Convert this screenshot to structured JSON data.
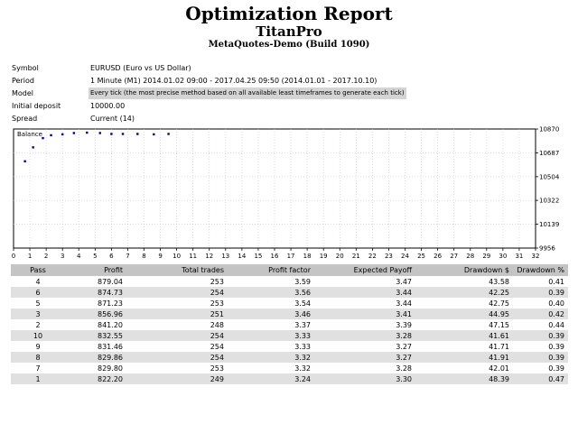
{
  "report": {
    "title": "Optimization Report",
    "expert": "TitanPro",
    "server": "MetaQuotes-Demo (Build 1090)"
  },
  "info": [
    {
      "label": "Symbol",
      "value": "EURUSD (Euro vs US Dollar)"
    },
    {
      "label": "Period",
      "value": "1 Minute (M1) 2014.01.02 09:00 - 2017.04.25 09:50 (2014.01.01 - 2017.10.10)"
    },
    {
      "label": "Model",
      "value": "Every tick (the most precise method based on all available least timeframes to generate each tick)"
    },
    {
      "label": "Initial deposit",
      "value": "10000.00"
    },
    {
      "label": "Spread",
      "value": "Current (14)"
    }
  ],
  "chart_data": {
    "type": "scatter",
    "title": "Balance",
    "xlim": [
      0,
      32
    ],
    "ylim": [
      9956,
      10870
    ],
    "x_ticks": [
      0,
      1,
      2,
      3,
      4,
      5,
      6,
      7,
      8,
      9,
      10,
      11,
      12,
      13,
      14,
      15,
      16,
      17,
      18,
      19,
      20,
      21,
      22,
      23,
      24,
      25,
      26,
      27,
      28,
      29,
      30,
      31,
      32
    ],
    "y_ticks": [
      9956,
      10139,
      10322,
      10504,
      10687,
      10870
    ],
    "grid": true,
    "color": "#00008b",
    "x": [
      0.7,
      1.2,
      1.8,
      2.3,
      3.0,
      3.7,
      4.5,
      5.3,
      6.0,
      6.7,
      7.6,
      8.6,
      9.5
    ],
    "y": [
      10622,
      10729,
      10800,
      10822,
      10829,
      10839,
      10842,
      10839,
      10832,
      10832,
      10832,
      10829,
      10832
    ]
  },
  "table": {
    "headers": [
      "Pass",
      "Profit",
      "Total trades",
      "Profit factor",
      "Expected Payoff",
      "Drawdown $",
      "Drawdown %"
    ],
    "rows": [
      [
        "4",
        "879.04",
        "253",
        "3.59",
        "3.47",
        "43.58",
        "0.41"
      ],
      [
        "6",
        "874.73",
        "254",
        "3.56",
        "3.44",
        "42.25",
        "0.39"
      ],
      [
        "5",
        "871.23",
        "253",
        "3.54",
        "3.44",
        "42.75",
        "0.40"
      ],
      [
        "3",
        "856.96",
        "251",
        "3.46",
        "3.41",
        "44.95",
        "0.42"
      ],
      [
        "2",
        "841.20",
        "248",
        "3.37",
        "3.39",
        "47.15",
        "0.44"
      ],
      [
        "10",
        "832.55",
        "254",
        "3.33",
        "3.28",
        "41.61",
        "0.39"
      ],
      [
        "9",
        "831.46",
        "254",
        "3.33",
        "3.27",
        "41.71",
        "0.39"
      ],
      [
        "8",
        "829.86",
        "254",
        "3.32",
        "3.27",
        "41.91",
        "0.39"
      ],
      [
        "7",
        "829.80",
        "253",
        "3.32",
        "3.28",
        "42.01",
        "0.39"
      ],
      [
        "1",
        "822.20",
        "249",
        "3.24",
        "3.30",
        "48.39",
        "0.47"
      ]
    ]
  }
}
